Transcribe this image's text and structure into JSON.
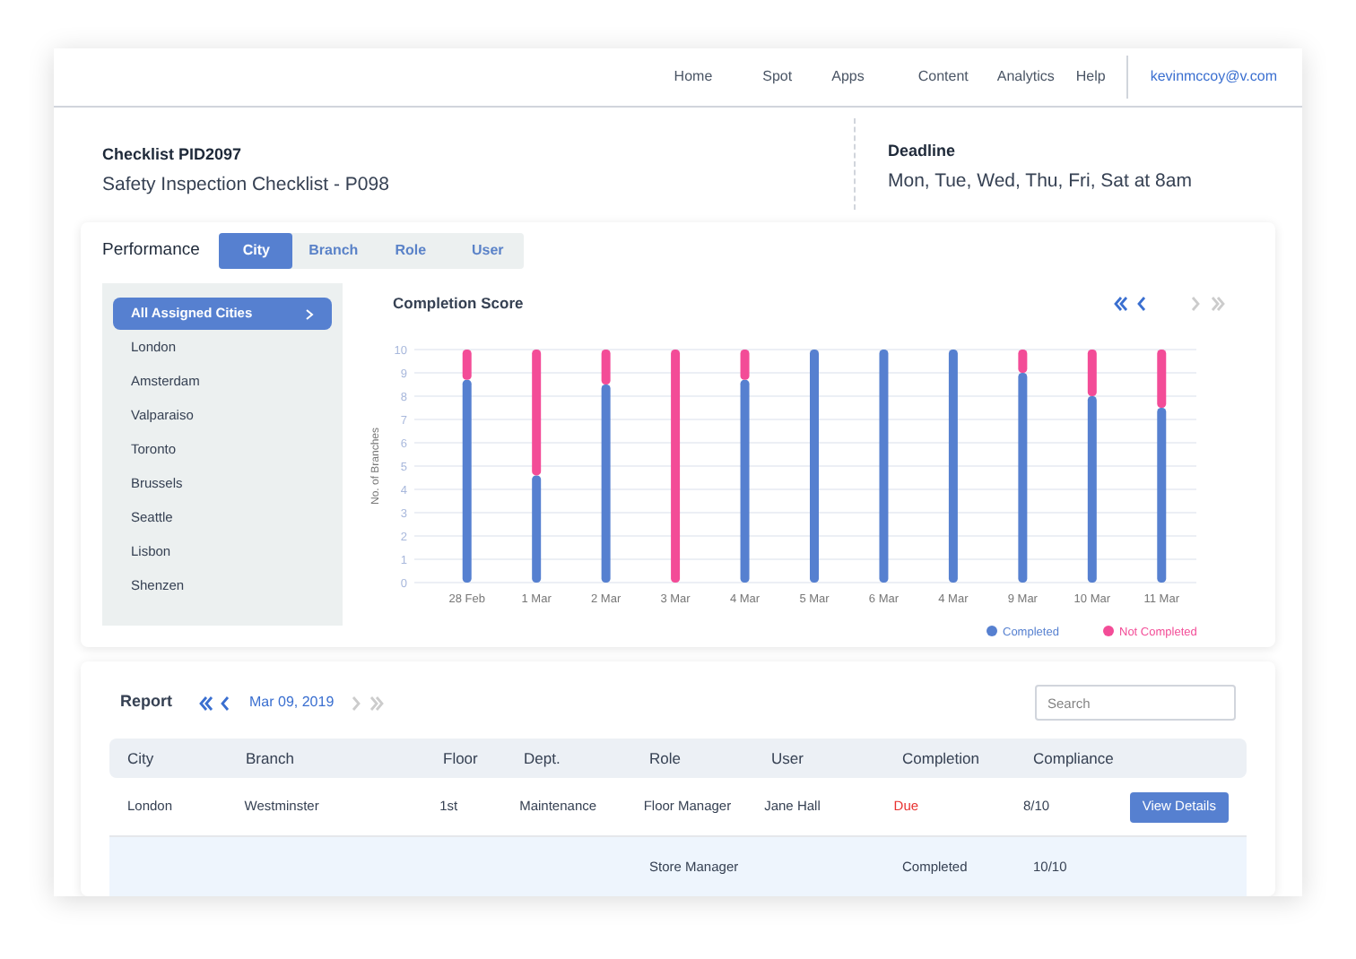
{
  "nav": {
    "items": [
      "Home",
      "Spot",
      "Apps",
      "Content",
      "Analytics",
      "Help"
    ],
    "user": "kevinmccoy@v.com"
  },
  "checklist": {
    "label": "Checklist PID2097",
    "name": "Safety Inspection Checklist - P098"
  },
  "deadline": {
    "label": "Deadline",
    "value": "Mon, Tue, Wed, Thu, Fri, Sat at 8am"
  },
  "performance": {
    "title": "Performance",
    "tabs": [
      {
        "label": "City",
        "selected": true
      },
      {
        "label": "Branch",
        "selected": false
      },
      {
        "label": "Role",
        "selected": false
      },
      {
        "label": "User",
        "selected": false
      }
    ],
    "cities": [
      {
        "label": "All Assigned Cities",
        "selected": true
      },
      {
        "label": "London",
        "selected": false
      },
      {
        "label": "Amsterdam",
        "selected": false
      },
      {
        "label": "Valparaiso",
        "selected": false
      },
      {
        "label": "Toronto",
        "selected": false
      },
      {
        "label": "Brussels",
        "selected": false
      },
      {
        "label": "Seattle",
        "selected": false
      },
      {
        "label": "Lisbon",
        "selected": false
      },
      {
        "label": "Shenzen",
        "selected": false
      }
    ],
    "chart_title": "Completion Score",
    "chart_data": {
      "type": "bar",
      "stacked": true,
      "grid": true,
      "legend": true,
      "ylabel": "No. of Branches",
      "categories": [
        "28 Feb",
        "1 Mar",
        "2 Mar",
        "3 Mar",
        "4 Mar",
        "5 Mar",
        "6 Mar",
        "4 Mar",
        "9 Mar",
        "10 Mar",
        "11 Mar"
      ],
      "ylim": [
        0,
        10
      ],
      "yticks": [
        0,
        1,
        2,
        3,
        4,
        5,
        6,
        7,
        8,
        9,
        10
      ],
      "series": [
        {
          "name": "Completed",
          "color": "#5680d0",
          "values": [
            8.7,
            4.6,
            8.5,
            0,
            8.7,
            10,
            10,
            10,
            9,
            8,
            7.5
          ]
        },
        {
          "name": "Not Completed",
          "color": "#f34c97",
          "values": [
            1.3,
            5.4,
            1.5,
            10,
            1.3,
            0,
            0,
            0,
            1,
            2,
            2.5
          ]
        }
      ]
    }
  },
  "report": {
    "title": "Report",
    "date": "Mar 09, 2019",
    "search": {
      "placeholder": "Search"
    },
    "columns": [
      "City",
      "Branch",
      "Floor",
      "Dept.",
      "Role",
      "User",
      "Completion",
      "Compliance"
    ],
    "rows": [
      {
        "cells": [
          "London",
          "Westminster",
          "1st",
          "Maintenance",
          "Floor Manager",
          "Jane Hall",
          "Due",
          "8/10"
        ],
        "kind": "due",
        "action": "View Details",
        "selected": false
      },
      {
        "cells": [
          null,
          null,
          null,
          null,
          "Store Manager",
          null,
          "Completed",
          "10/10"
        ],
        "kind": "done",
        "selected": true
      }
    ]
  }
}
